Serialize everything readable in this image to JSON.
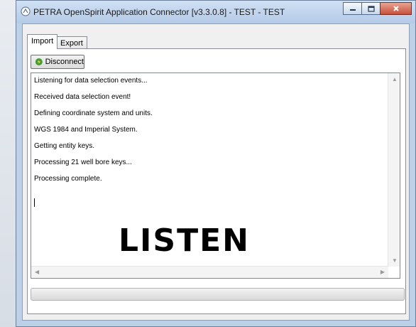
{
  "window": {
    "title": "PETRA OpenSpirit Application Connector [v3.3.0.8] - TEST - TEST"
  },
  "tabs": [
    {
      "label": "Import",
      "active": true
    },
    {
      "label": "Export",
      "active": false
    }
  ],
  "import": {
    "disconnect_label": "Disconnect",
    "log_lines": [
      "Listening for data selection events...",
      "Received data selection event!",
      "Defining coordinate system and units.",
      "WGS 1984 and Imperial System.",
      "Getting entity keys.",
      "Processing 21 well bore keys...",
      "Processing complete."
    ],
    "watermark": "LISTEN",
    "progress": 0
  },
  "icons": {
    "app": "petra-app-icon",
    "disconnect": "lightning-plug-icon",
    "minimize": "minimize-icon",
    "maximize": "maximize-icon",
    "close": "close-icon"
  },
  "colors": {
    "titlebar": "#bcd0e8",
    "close_button": "#c7503a",
    "disconnect_icon": "#3aa03a"
  }
}
